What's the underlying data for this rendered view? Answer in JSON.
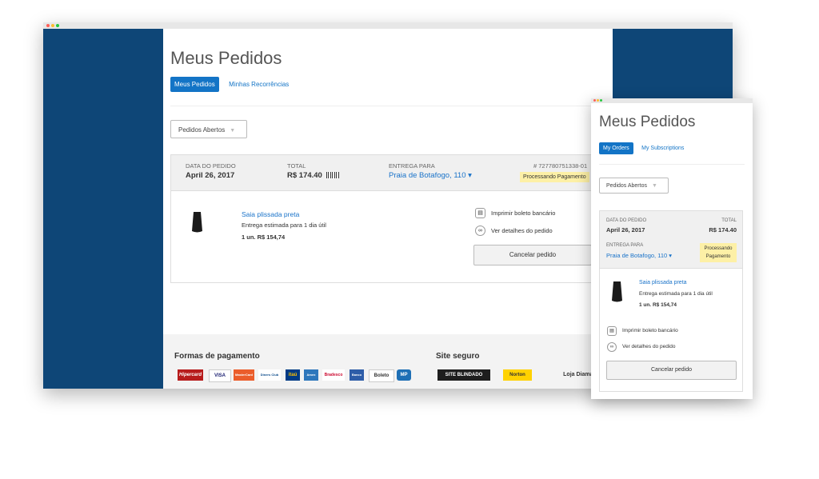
{
  "desktop": {
    "page_title": "Meus Pedidos",
    "tabs": [
      "Meus Pedidos",
      "Minhas Recorrências"
    ],
    "filter": "Pedidos Abertos",
    "order": {
      "date_label": "DATA DO PEDIDO",
      "date": "April 26, 2017",
      "total_label": "TOTAL",
      "total": "R$ 174.40",
      "delivery_label": "ENTREGA PARA",
      "delivery": "Praia de Botafogo, 110 ▾",
      "number": "# 727780751338-01",
      "status": "Processando Pagamento"
    },
    "item": {
      "name": "Saia plissada preta",
      "delivery_estimate": "Entrega estimada para 1 dia útil",
      "qty_price": "1 un.  R$ 154,74"
    },
    "actions": {
      "print": "Imprimir boleto bancário",
      "details": "Ver detalhes do pedido",
      "cancel": "Cancelar pedido"
    },
    "footer": {
      "payment_title": "Formas de pagamento",
      "secure_title": "Site seguro",
      "payment_logos": [
        "Hipercard",
        "VISA",
        "MasterCard",
        "Diners Club",
        "itaú",
        "Amex",
        "Bradesco",
        "Banco",
        "Boleto",
        "MP"
      ],
      "secure_logos": [
        "SITE BLINDADO",
        "Norton",
        "Loja Diamante"
      ]
    }
  },
  "mobile": {
    "page_title": "Meus Pedidos",
    "tabs": [
      "My Orders",
      "My Subscriptions"
    ],
    "filter": "Pedidos Abertos",
    "order": {
      "date_label": "DATA DO PEDIDO",
      "date": "April 26, 2017",
      "total_label": "TOTAL",
      "total": "R$ 174.40",
      "delivery_label": "ENTREGA PARA",
      "delivery": "Praia de Botafogo, 110 ▾",
      "status_line1": "Processando",
      "status_line2": "Pagamento"
    },
    "item": {
      "name": "Saia plissada preta",
      "delivery_estimate": "Entrega estimada para 1 dia útil",
      "qty_price": "1 un.  R$ 154,74"
    },
    "actions": {
      "print": "Imprimir boleto bancário",
      "details": "Ver detalhes do pedido",
      "cancel": "Cancelar pedido"
    }
  },
  "colors": {
    "sidebar": "#0e4677",
    "accent": "#1374c6",
    "badge": "#fdf0a6"
  }
}
